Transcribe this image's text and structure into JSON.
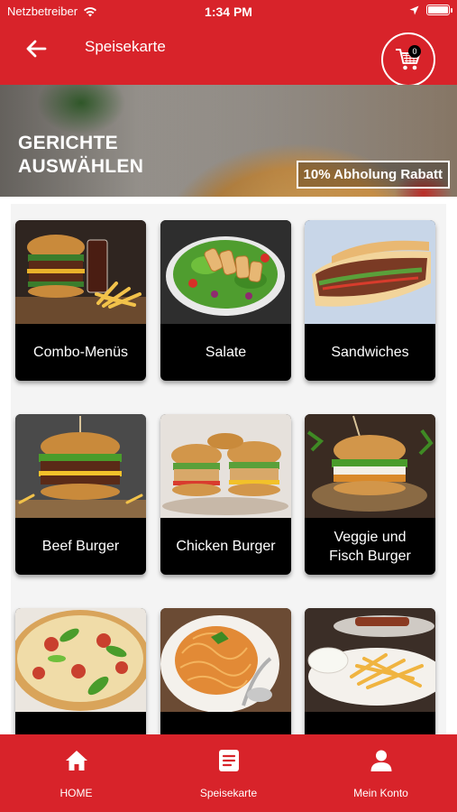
{
  "status_bar": {
    "carrier": "Netzbetreiber",
    "time": "1:34 PM",
    "icons": [
      "wifi-icon",
      "location-arrow-icon",
      "battery-icon"
    ]
  },
  "header": {
    "title": "Speisekarte",
    "back_icon": "arrow-left-icon",
    "cart_icon": "shopping-cart-icon",
    "cart_count": "0"
  },
  "banner": {
    "title_line1": "GERICHTE",
    "title_line2": "AUSWÄHLEN",
    "discount": "10% Abholung Rabatt"
  },
  "categories": [
    {
      "label": "Combo-Menüs",
      "image": "burger-fries-drink"
    },
    {
      "label": "Salate",
      "image": "chicken-salad"
    },
    {
      "label": "Sandwiches",
      "image": "doner-sandwich"
    },
    {
      "label": "Beef Burger",
      "image": "beef-burger"
    },
    {
      "label": "Chicken Burger",
      "image": "chicken-burgers"
    },
    {
      "label": "Veggie und\nFisch Burger",
      "image": "veggie-burger"
    },
    {
      "label": "",
      "image": "pizza"
    },
    {
      "label": "",
      "image": "spaghetti"
    },
    {
      "label": "",
      "image": "fries-plate"
    }
  ],
  "bottom_nav": [
    {
      "label": "HOME",
      "icon": "home-icon"
    },
    {
      "label": "Speisekarte",
      "icon": "menu-list-icon"
    },
    {
      "label": "Mein Konto",
      "icon": "user-icon"
    }
  ],
  "colors": {
    "brand_red": "#d8232a",
    "card_label_bg": "#000000",
    "grid_bg": "#f4f4f4"
  }
}
